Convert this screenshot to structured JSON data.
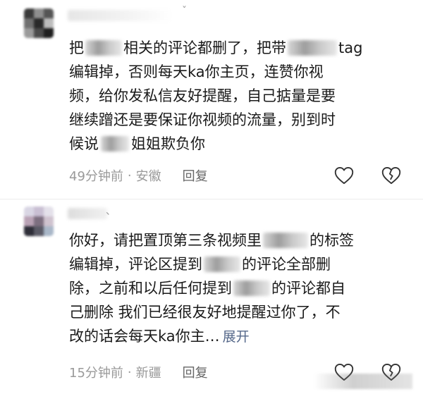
{
  "comments": [
    {
      "uname_mark": "ˇ",
      "lines": [
        {
          "a": "把",
          "b": "相关的评论都删了，把带",
          "c": "tag"
        },
        {
          "a": "编辑掉，否则每天ka你主页，连赞你视"
        },
        {
          "a": "频，给你发私信友好提醒，自己掂量是要"
        },
        {
          "a": "继续蹭还是要保证你视频的流量，别到时"
        },
        {
          "a": "候说",
          "b": "姐姐欺负你"
        }
      ],
      "time": "49分钟前",
      "dot": "·",
      "location": "安徽",
      "reply": "回复"
    },
    {
      "uname_mark": "、",
      "lines": [
        {
          "a": "你好，请把置顶第三条视频里",
          "b": "的标签"
        },
        {
          "a": "编辑掉，评论区提到",
          "b": "的评论全部删"
        },
        {
          "a": "除，之前和以后任何提到",
          "b": "的评论都自"
        },
        {
          "a": "己删除 我们已经很友好地提醒过你了，不"
        },
        {
          "a": "改的话会每天ka你主…",
          "expand": "展开"
        }
      ],
      "time": "15分钟前",
      "dot": "·",
      "location": "新疆",
      "reply": "回复"
    }
  ],
  "colors": {
    "text": "#1a1a1a",
    "meta": "#9a9a9a",
    "expand": "#55688a",
    "icon": "#333333"
  },
  "icons": {
    "like": "heart-outline-icon",
    "dislike": "broken-heart-icon"
  }
}
